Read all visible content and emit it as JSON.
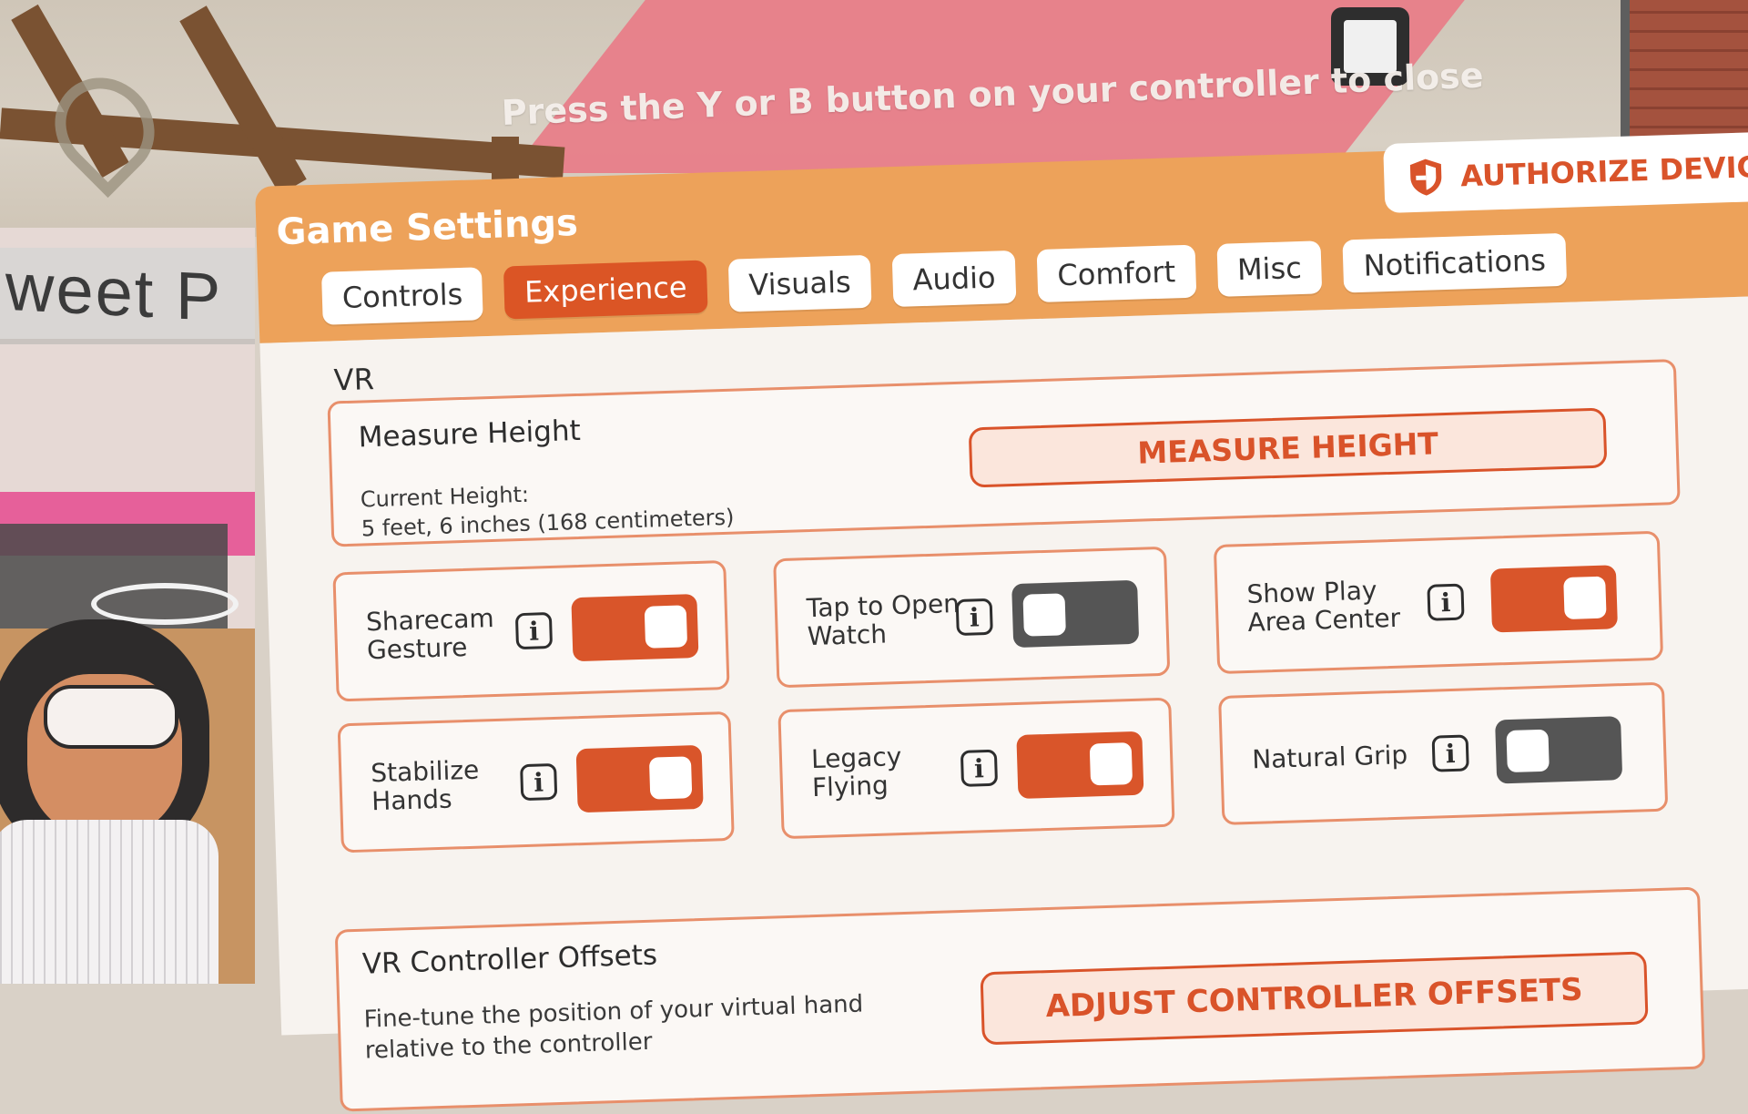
{
  "overlay": {
    "hint": "Press the Y or B button on your controller to close"
  },
  "background": {
    "store_sign": "weet P"
  },
  "header": {
    "title": "Game Settings",
    "authorize_label": "AUTHORIZE DEVICE",
    "authorize_icon": "shield-icon"
  },
  "tabs": [
    {
      "label": "Controls",
      "active": false
    },
    {
      "label": "Experience",
      "active": true
    },
    {
      "label": "Visuals",
      "active": false
    },
    {
      "label": "Audio",
      "active": false
    },
    {
      "label": "Comfort",
      "active": false
    },
    {
      "label": "Misc",
      "active": false
    },
    {
      "label": "Notifications",
      "active": false
    }
  ],
  "section": {
    "label": "VR"
  },
  "measure_height": {
    "title": "Measure Height",
    "current_label": "Current Height:",
    "current_value": "5 feet, 6 inches (168 centimeters)",
    "button_label": "MEASURE HEIGHT"
  },
  "toggles": [
    {
      "label": "Sharecam Gesture",
      "on": true
    },
    {
      "label": "Tap to Open Watch",
      "on": false
    },
    {
      "label": "Show Play Area Center",
      "on": true
    },
    {
      "label": "Stabilize Hands",
      "on": true
    },
    {
      "label": "Legacy Flying",
      "on": true
    },
    {
      "label": "Natural Grip",
      "on": false
    }
  ],
  "info_glyph": "i",
  "vr_offsets": {
    "title": "VR Controller Offsets",
    "description": "Fine-tune the position of your virtual hand relative to the controller",
    "button_label": "ADJUST CONTROLLER OFFSETS"
  },
  "colors": {
    "accent": "#db5525",
    "header": "#eda25a",
    "toggle_off": "#555555"
  }
}
